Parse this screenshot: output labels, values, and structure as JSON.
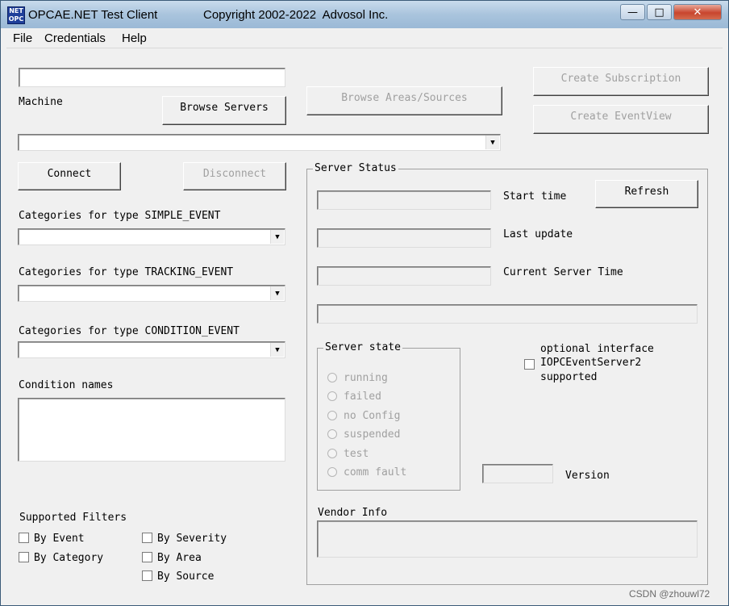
{
  "window": {
    "app_icon_text": "NET OPC",
    "title": "OPCAE.NET Test Client",
    "copyright": "Copyright 2002-2022  Advosol Inc.",
    "minimize_glyph": "—",
    "maximize_glyph": "□",
    "close_glyph": "✕"
  },
  "menu": {
    "file": "File",
    "credentials": "Credentials",
    "help": "Help"
  },
  "machine": {
    "label": "Machine",
    "value": "",
    "browse_servers": "Browse Servers",
    "server_value": ""
  },
  "buttons": {
    "browse_areas": "Browse Areas/Sources",
    "create_subscription": "Create Subscription",
    "create_eventview": "Create EventView",
    "connect": "Connect",
    "disconnect": "Disconnect",
    "refresh": "Refresh"
  },
  "categories": {
    "simple": "Categories for type SIMPLE_EVENT",
    "tracking": "Categories for type TRACKING_EVENT",
    "condition": "Categories for type CONDITION_EVENT"
  },
  "condition_names": "Condition names",
  "filters": {
    "title": "Supported Filters",
    "by_event": "By Event",
    "by_category": "By Category",
    "by_severity": "By Severity",
    "by_area": "By Area",
    "by_source": "By Source"
  },
  "server_status": {
    "title": "Server Status",
    "start_time": "Start time",
    "last_update": "Last update",
    "current_server_time": "Current Server Time",
    "server_state_title": "Server state",
    "states": [
      "running",
      "failed",
      "no Config",
      "suspended",
      "test",
      "comm fault"
    ],
    "optional_interface_1": "optional interface",
    "optional_interface_2": "IOPCEventServer2",
    "optional_interface_3": "supported",
    "version": "Version",
    "vendor_info": "Vendor Info"
  },
  "watermark": "CSDN @zhouwl72",
  "icons": {
    "dropdown": "chevron-down-icon",
    "app": "opc-app-icon"
  },
  "colors": {
    "titlebar": "#a9c4dd",
    "dialog": "#f0f0f0",
    "disabled_text": "#a0a0a0",
    "close": "#c8452d"
  }
}
